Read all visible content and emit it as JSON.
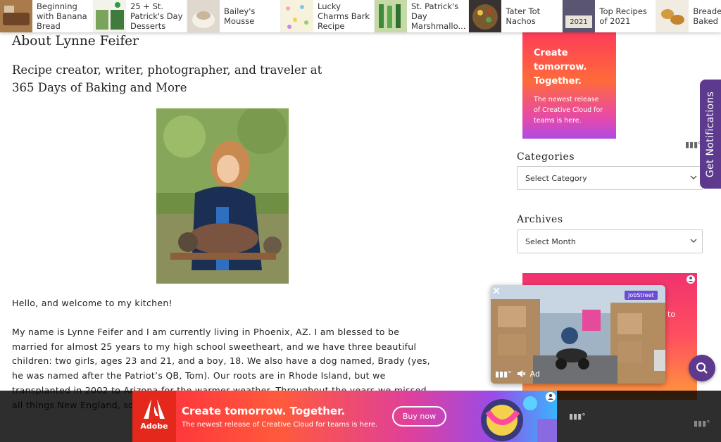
{
  "topbar": {
    "items": [
      {
        "label": "Beginning with Banana Bread"
      },
      {
        "label": "25 + St. Patrick's Day Desserts"
      },
      {
        "label": "Bailey's Mousse"
      },
      {
        "label": "Lucky Charms Bark Recipe"
      },
      {
        "label": "St. Patrick's Day Marshmallo..."
      },
      {
        "label": "Tater Tot Nachos"
      },
      {
        "label": "Top Recipes of 2021"
      },
      {
        "label": "Breaded Baked R"
      }
    ],
    "thumb_badge_2021": "2021"
  },
  "main": {
    "title": "About Lynne Feifer",
    "tagline": "Recipe creator, writer, photographer, and traveler at 365 Days of Baking and More",
    "paragraphs": [
      "Hello, and welcome to my kitchen!",
      "My name is Lynne Feifer and I am currently living in Phoenix, AZ. I am blessed to be married for almost 25 years to my high school sweetheart, and we have three beautiful children: two girls, ages 23 and 21, and a boy, 18. We also have a dog named, Brady (yes, he was named after the Patriot’s QB, Tom). Our roots are in Rhode Island, but we transplanted in 2002 to Arizona for the warmer weather. Throughout the years we missed all things New England, so ... area of New Hampshire. A... back to Phoenix, AZ decid..."
    ]
  },
  "sidebar": {
    "ad_top": {
      "headline": "Create tomorrow. Together.",
      "sub": "The newest release of Creative Cloud for teams is here."
    },
    "categories": {
      "title": "Categories",
      "selected": "Select Category"
    },
    "archives": {
      "title": "Archives",
      "selected": "Select Month"
    },
    "ad_second_text": "to"
  },
  "notifications": {
    "label": "Get Notifications"
  },
  "video": {
    "brand_tag": "JobStreet",
    "ad_label": "Ad"
  },
  "bottom_ad": {
    "brand": "Adobe",
    "headline": "Create tomorrow. Together.",
    "sub": "The newest release of Creative Cloud for teams is here.",
    "button": "Buy now"
  },
  "colors": {
    "accent_purple": "#5d3a8e",
    "adobe_red": "#e4281b"
  }
}
